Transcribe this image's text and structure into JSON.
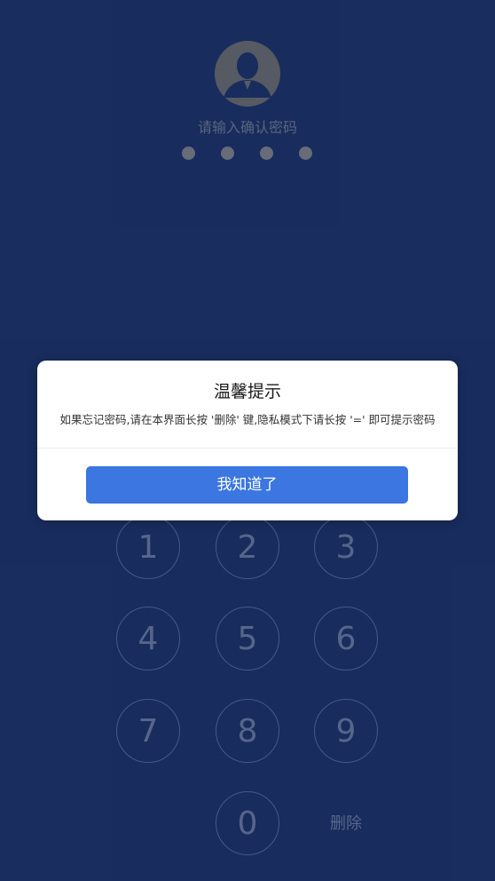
{
  "lock": {
    "prompt": "请输入确认密码",
    "dots_count": 4
  },
  "keypad": {
    "keys": [
      "1",
      "2",
      "3",
      "4",
      "5",
      "6",
      "7",
      "8",
      "9",
      "0"
    ],
    "delete_label": "删除"
  },
  "dialog": {
    "title": "温馨提示",
    "message": "如果忘记密码,请在本界面长按 '删除' 键,隐私模式下请长按 '=' 即可提示密码",
    "confirm_label": "我知道了"
  },
  "colors": {
    "background": "#1a2f63",
    "accent": "#3b76e1",
    "dialog_bg": "#ffffff"
  },
  "icons": {
    "avatar": "user-avatar-icon"
  }
}
